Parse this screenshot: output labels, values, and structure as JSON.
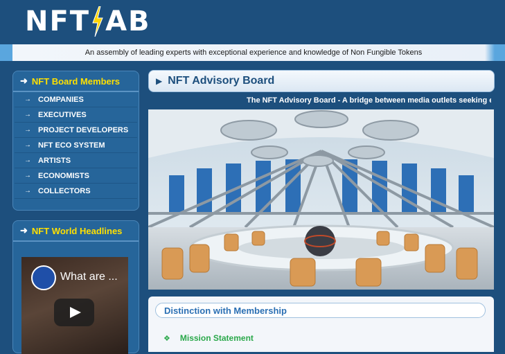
{
  "header": {
    "logo_left": "NFT",
    "logo_right": "AB",
    "tagline": "An assembly of leading experts with exceptional experience and knowledge of Non Fungible Tokens"
  },
  "sidebar": {
    "board_title": "NFT Board Members",
    "items": [
      {
        "label": "COMPANIES"
      },
      {
        "label": "EXECUTIVES"
      },
      {
        "label": "PROJECT DEVELOPERS"
      },
      {
        "label": "NFT ECO SYSTEM"
      },
      {
        "label": "ARTISTS"
      },
      {
        "label": "ECONOMISTS"
      },
      {
        "label": "COLLECTORS"
      }
    ],
    "headlines_title": "NFT World Headlines",
    "video_title": "What are ..."
  },
  "main": {
    "title": "NFT Advisory Board",
    "marquee": "The NFT Advisory Board - A bridge between media outlets seeking expe",
    "distinction_title": "Distinction with Membership",
    "mission_label": "Mission Statement"
  },
  "icons": {
    "menu_arrow": "right-arrow-icon",
    "title_arrow": "right-triangle-icon",
    "bullet": "diamond-bullet-icon"
  },
  "colors": {
    "background": "#1d4f7d",
    "heading_yellow": "#ffe000",
    "accent_green": "#2aa84a",
    "title_blue": "#1d4f7d"
  }
}
